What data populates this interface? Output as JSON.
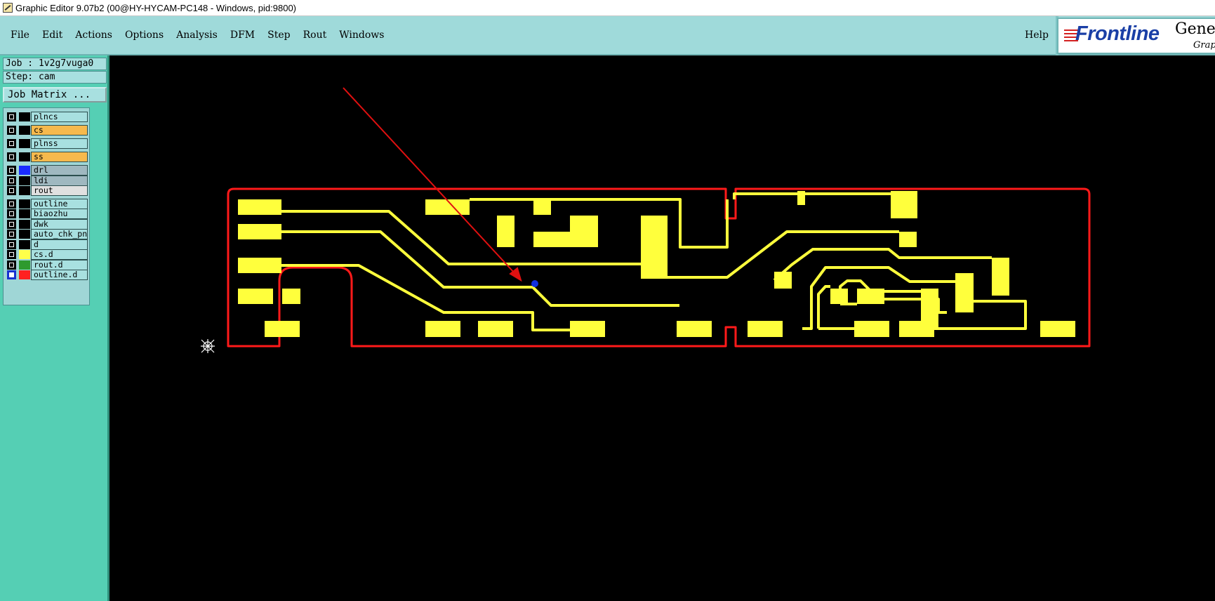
{
  "window": {
    "title": "Graphic Editor 9.07b2 (00@HY-HYCAM-PC148 - Windows, pid:9800)"
  },
  "menubar": {
    "items": [
      {
        "label": "File"
      },
      {
        "label": "Edit"
      },
      {
        "label": "Actions"
      },
      {
        "label": "Options"
      },
      {
        "label": "Analysis"
      },
      {
        "label": "DFM"
      },
      {
        "label": "Step"
      },
      {
        "label": "Rout"
      },
      {
        "label": "Windows"
      }
    ],
    "help": "Help"
  },
  "logo": {
    "brand": "Frontline",
    "product": "Gene",
    "product_sub": "Grap"
  },
  "sidebar": {
    "job": "Job : 1v2g7vuga0",
    "step": "Step: cam",
    "job_matrix": "Job Matrix ...",
    "layers": [
      {
        "name": "plncs",
        "label_color": "#a8e0e0",
        "swatch": "#000000",
        "active": false
      },
      {
        "name": "cs",
        "label_color": "#f6b94d",
        "swatch": "#000000",
        "active": false
      },
      {
        "name": "plnss",
        "label_color": "#a8e0e0",
        "swatch": "#000000",
        "active": false
      },
      {
        "name": "ss",
        "label_color": "#f6b94d",
        "swatch": "#000000",
        "active": false
      },
      {
        "name": "drl",
        "label_color": "#9fb8c0",
        "swatch": "#1a2cff",
        "active": false
      },
      {
        "name": "ldi",
        "label_color": "#9fb8c0",
        "swatch": "#000000",
        "active": false
      },
      {
        "name": "rout",
        "label_color": "#e0e0e0",
        "swatch": "#000000",
        "active": false
      },
      {
        "name": "outline",
        "label_color": "#a8e0e0",
        "swatch": "#000000",
        "active": false
      },
      {
        "name": "biaozhu",
        "label_color": "#a8e0e0",
        "swatch": "#000000",
        "active": false
      },
      {
        "name": "dwk",
        "label_color": "#a8e0e0",
        "swatch": "#000000",
        "active": false
      },
      {
        "name": "auto_chk_pnl",
        "label_color": "#a8e0e0",
        "swatch": "#000000",
        "active": false
      },
      {
        "name": "d",
        "label_color": "#a8e0e0",
        "swatch": "#000000",
        "active": false
      },
      {
        "name": "cs.d",
        "label_color": "#a8e0e0",
        "swatch": "#ffff4a",
        "active": false
      },
      {
        "name": "rout.d",
        "label_color": "#a8e0e0",
        "swatch": "#2e9a2e",
        "active": false
      },
      {
        "name": "outline.d",
        "label_color": "#a8e0e0",
        "swatch": "#ff2020",
        "active": true
      }
    ]
  },
  "colors": {
    "copper": "#ffff3c",
    "outline": "#ff1a1a",
    "drill": "#1030e0",
    "canvas": "#000000"
  }
}
